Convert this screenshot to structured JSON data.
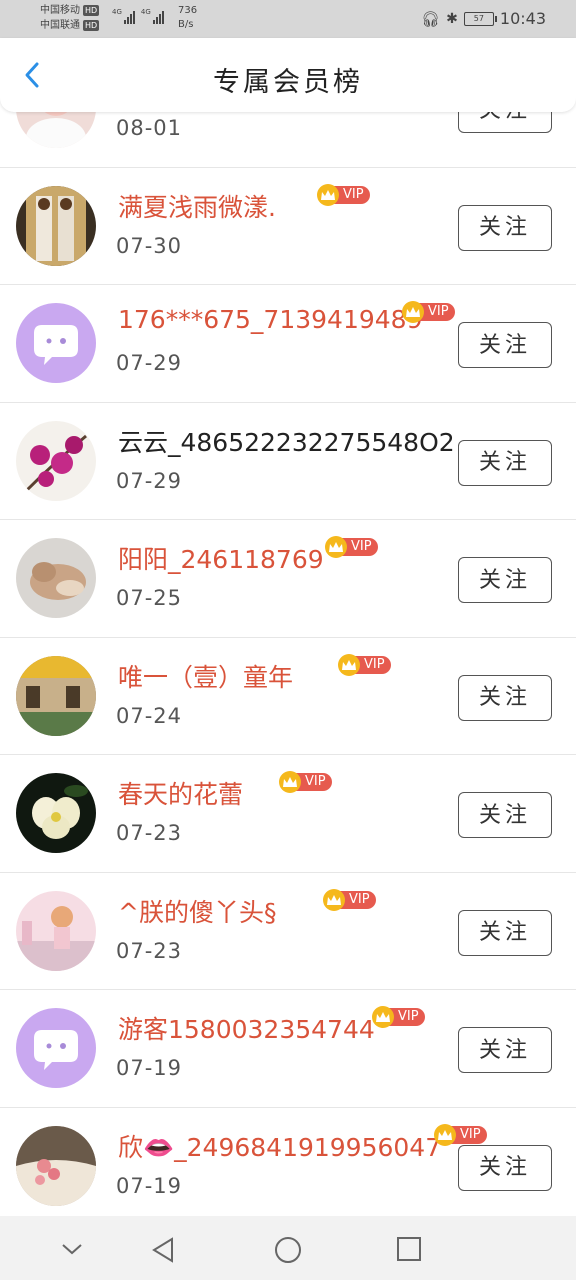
{
  "status_bar": {
    "carrier1": "中国移动",
    "carrier2": "中国联通",
    "hd": "HD",
    "net": "4G",
    "speed_value": "736",
    "speed_unit": "B/s",
    "battery": "57",
    "time": "10:43"
  },
  "header": {
    "title": "专属会员榜"
  },
  "vip_label": "VIP",
  "members": [
    {
      "name": "",
      "date": "08-01",
      "vip": false,
      "name_color": "red",
      "follow": "关注"
    },
    {
      "name": "满夏浅雨微漾.",
      "date": "07-30",
      "vip": true,
      "name_color": "red",
      "follow": "关注"
    },
    {
      "name": "176***675_7139419489",
      "date": "07-29",
      "vip": true,
      "name_color": "red",
      "follow": "关注"
    },
    {
      "name": "云云_486522232275548O2",
      "date": "07-29",
      "vip": false,
      "name_color": "black",
      "follow": "关注"
    },
    {
      "name": "阳阳_246118769",
      "date": "07-25",
      "vip": true,
      "name_color": "red",
      "follow": "关注"
    },
    {
      "name": "唯一（壹）童年",
      "date": "07-24",
      "vip": true,
      "name_color": "red",
      "follow": "关注"
    },
    {
      "name": "春天的花蕾",
      "date": "07-23",
      "vip": true,
      "name_color": "red",
      "follow": "关注"
    },
    {
      "name": "^朕的傻丫头§",
      "date": "07-23",
      "vip": true,
      "name_color": "red",
      "follow": "关注"
    },
    {
      "name": "游客1580032354744",
      "date": "07-19",
      "vip": true,
      "name_color": "red",
      "follow": "关注"
    },
    {
      "name": "欣👄_2496841919956047",
      "date": "07-19",
      "vip": true,
      "name_color": "red",
      "follow": "关注"
    }
  ],
  "colors": {
    "name_red": "#d9533a",
    "vip_badge": "#e65a4e",
    "crown": "#f5b81c",
    "back_arrow": "#2b8fe6"
  }
}
